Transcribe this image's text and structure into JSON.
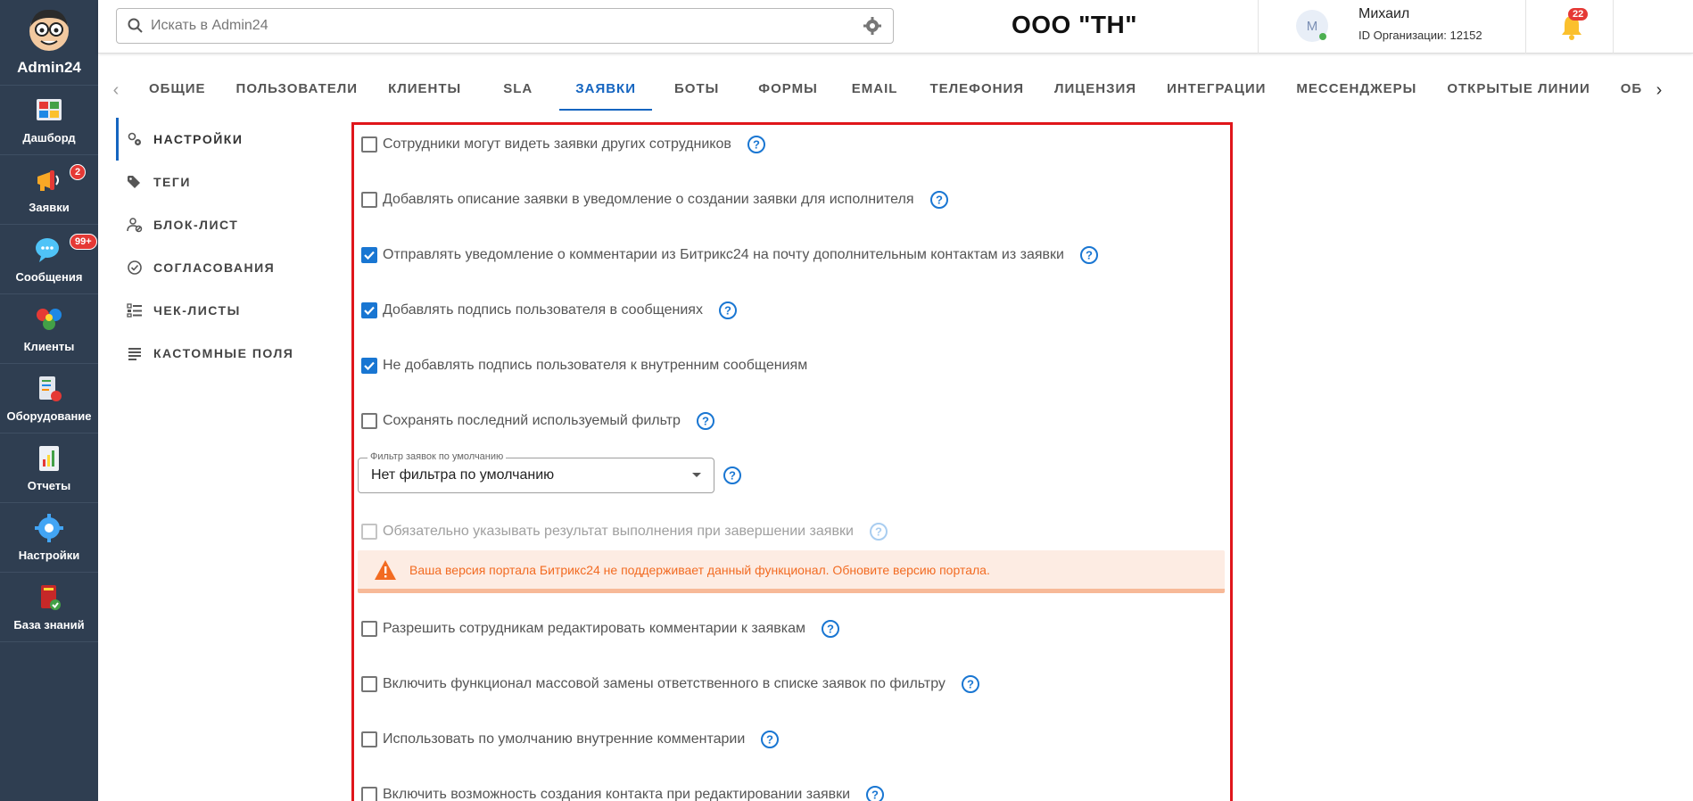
{
  "app": {
    "name": "Admin24",
    "nav": [
      {
        "label": "Дашборд",
        "icon": "dashboard-icon"
      },
      {
        "label": "Заявки",
        "icon": "megaphone-icon",
        "badge": "2"
      },
      {
        "label": "Сообщения",
        "icon": "chat-icon",
        "badge": "99+"
      },
      {
        "label": "Клиенты",
        "icon": "clients-icon"
      },
      {
        "label": "Оборудование",
        "icon": "equipment-icon"
      },
      {
        "label": "Отчеты",
        "icon": "reports-icon"
      },
      {
        "label": "Настройки",
        "icon": "gear-icon"
      },
      {
        "label": "База знаний",
        "icon": "book-icon"
      }
    ]
  },
  "header": {
    "search_placeholder": "Искать в Admin24",
    "org_title": "ООО \"ТН\"",
    "user": {
      "initial": "М",
      "name": "Михаил",
      "org_id": "ID Организации: 12152"
    },
    "notifications_count": "22",
    "help": "?"
  },
  "tabs": {
    "items": [
      "ОБЩИЕ",
      "ПОЛЬЗОВАТЕЛИ",
      "КЛИЕНТЫ",
      "SLA",
      "ЗАЯВКИ",
      "БОТЫ",
      "ФОРМЫ",
      "EMAIL",
      "ТЕЛЕФОНИЯ",
      "ЛИЦЕНЗИЯ",
      "ИНТЕГРАЦИИ",
      "МЕССЕНДЖЕРЫ",
      "ОТКРЫТЫЕ ЛИНИИ",
      "ОБОРУДОВАН"
    ],
    "active": "ЗАЯВКИ"
  },
  "settings_menu": {
    "items": [
      "НАСТРОЙКИ",
      "ТЕГИ",
      "БЛОК-ЛИСТ",
      "СОГЛАСОВАНИЯ",
      "ЧЕК-ЛИСТЫ",
      "КАСТОМНЫЕ ПОЛЯ"
    ],
    "active": "НАСТРОЙКИ"
  },
  "options": {
    "opt1": {
      "label": "Сотрудники могут видеть заявки других сотрудников",
      "checked": false
    },
    "opt2": {
      "label": "Добавлять описание заявки в уведомление о создании заявки для исполнителя",
      "checked": false
    },
    "opt3": {
      "label": "Отправлять уведомление о комментарии из Битрикс24 на почту дополнительным контактам из заявки",
      "checked": true
    },
    "opt4": {
      "label": "Добавлять подпись пользователя в сообщениях",
      "checked": true
    },
    "opt5": {
      "label": "Не добавлять подпись пользователя к внутренним сообщениям",
      "checked": true
    },
    "opt6": {
      "label": "Сохранять последний используемый фильтр",
      "checked": false
    },
    "opt7": {
      "label": "Обязательно указывать результат выполнения при завершении заявки",
      "checked": false,
      "disabled": true
    },
    "opt8": {
      "label": "Разрешить сотрудникам редактировать комментарии к заявкам",
      "checked": false
    },
    "opt9": {
      "label": "Включить функционал массовой замены ответственного в списке заявок по фильтру",
      "checked": false
    },
    "opt10": {
      "label": "Использовать по умолчанию внутренние комментарии",
      "checked": false
    },
    "opt11": {
      "label": "Включить возможность создания контакта при редактировании заявки",
      "checked": false
    }
  },
  "filter_select": {
    "legend": "Фильтр заявок по умолчанию",
    "value": "Нет фильтра по умолчанию"
  },
  "warning": {
    "text": "Ваша версия портала Битрикс24 не поддерживает данный функционал. Обновите версию портала."
  },
  "colors": {
    "sidebar": "#2f3e51",
    "accent": "#1565c0",
    "checkbox": "#1976d2",
    "highlight_border": "#e0161b",
    "warning_text": "#f26b22",
    "warning_bg": "#fdece3",
    "badge": "#e53935"
  }
}
